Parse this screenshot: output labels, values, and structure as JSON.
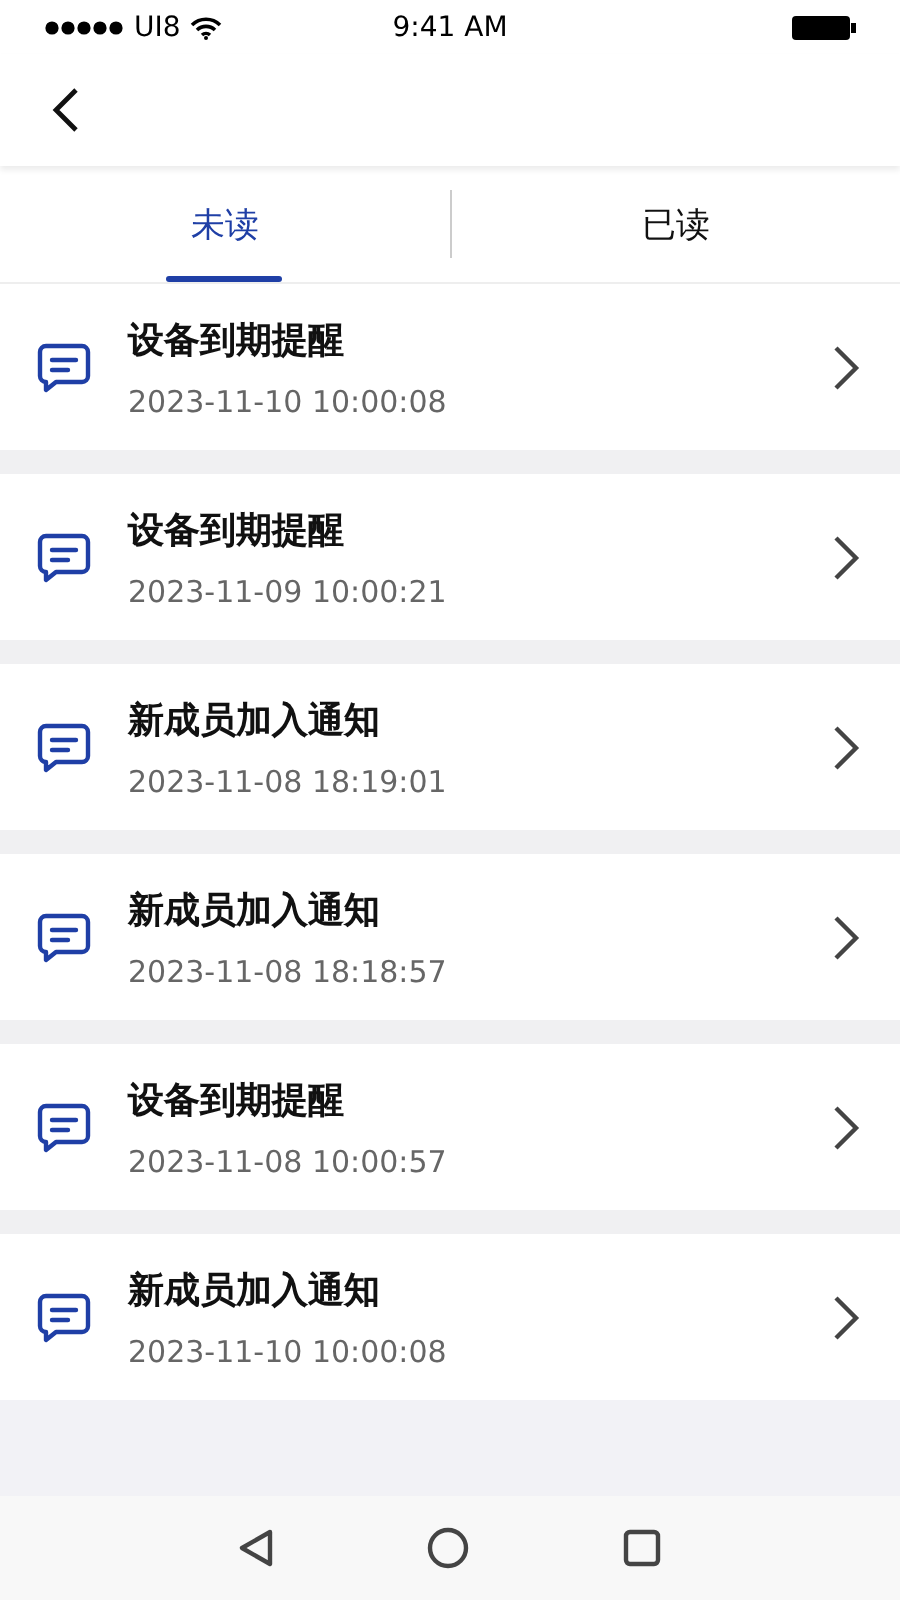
{
  "status_bar": {
    "carrier": "UI8",
    "time": "9:41 AM"
  },
  "tabs": [
    {
      "label": "未读",
      "selected": true
    },
    {
      "label": "已读",
      "selected": false
    }
  ],
  "messages": [
    {
      "title": "设备到期提醒",
      "time": "2023-11-10 10:00:08"
    },
    {
      "title": "设备到期提醒",
      "time": "2023-11-09 10:00:21"
    },
    {
      "title": "新成员加入通知",
      "time": "2023-11-08 18:19:01"
    },
    {
      "title": "新成员加入通知",
      "time": "2023-11-08 18:18:57"
    },
    {
      "title": "设备到期提醒",
      "time": "2023-11-08 10:00:57"
    },
    {
      "title": "新成员加入通知",
      "time": "2023-11-10 10:00:08"
    }
  ]
}
